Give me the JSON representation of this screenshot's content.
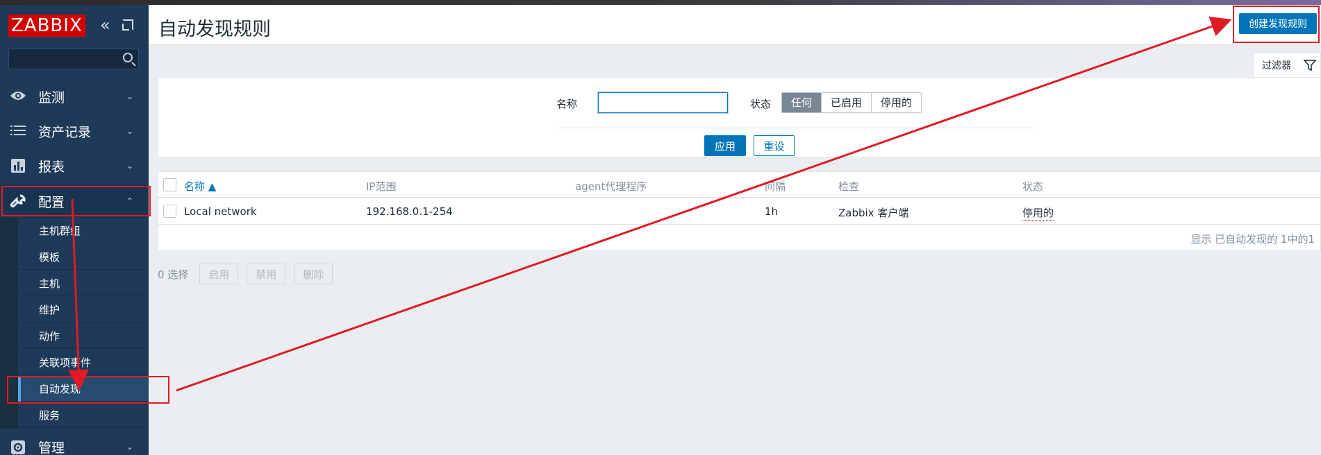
{
  "sidebar": {
    "logo": "ZABBIX",
    "collapse_icon": "chevrons-left-icon",
    "kiosk_icon": "kiosk-mode-icon",
    "search": {
      "value": "",
      "icon": "search-icon"
    },
    "menu": [
      {
        "label": "监测",
        "icon": "eye-icon",
        "glyph": "👁",
        "expanded": false
      },
      {
        "label": "资产记录",
        "icon": "list-icon",
        "glyph": "☰",
        "expanded": false
      },
      {
        "label": "报表",
        "icon": "bar-chart-icon",
        "glyph": "▥",
        "expanded": false
      },
      {
        "label": "配置",
        "icon": "wrench-icon",
        "glyph": "🔧",
        "expanded": true
      },
      {
        "label": "管理",
        "icon": "gear-icon",
        "glyph": "⚙",
        "expanded": false
      }
    ],
    "submenu": [
      {
        "label": "主机群组"
      },
      {
        "label": "模板"
      },
      {
        "label": "主机"
      },
      {
        "label": "维护"
      },
      {
        "label": "动作"
      },
      {
        "label": "关联项事件"
      },
      {
        "label": "自动发现",
        "active": true
      },
      {
        "label": "服务"
      }
    ]
  },
  "header": {
    "title": "自动发现规则",
    "create_button": "创建发现规则"
  },
  "filter": {
    "tab_label": "过滤器",
    "name_label": "名称",
    "name_value": "",
    "status_label": "状态",
    "status_options": [
      "任何",
      "已启用",
      "停用的"
    ],
    "status_selected": "任何",
    "apply_label": "应用",
    "reset_label": "重设"
  },
  "table": {
    "columns": {
      "name": "名称 ▲",
      "ip_range": "IP范围",
      "proxy": "agent代理程序",
      "interval": "间隔",
      "checks": "检查",
      "status": "状态"
    },
    "rows": [
      {
        "name": "Local network",
        "ip_range": "192.168.0.1-254",
        "proxy": "",
        "interval": "1h",
        "checks": "Zabbix 客户端",
        "status": "停用的"
      }
    ],
    "footer": "显示 已自动发现的 1中的1"
  },
  "bulk_actions": {
    "selected": "0 选择",
    "enable": "启用",
    "disable": "禁用",
    "delete": "删除"
  },
  "colors": {
    "sidebar": "#1f3a59",
    "accent": "#0275b8",
    "logo": "#d40000",
    "annotation": "#e01b24",
    "disabled_status": "#d40000"
  }
}
